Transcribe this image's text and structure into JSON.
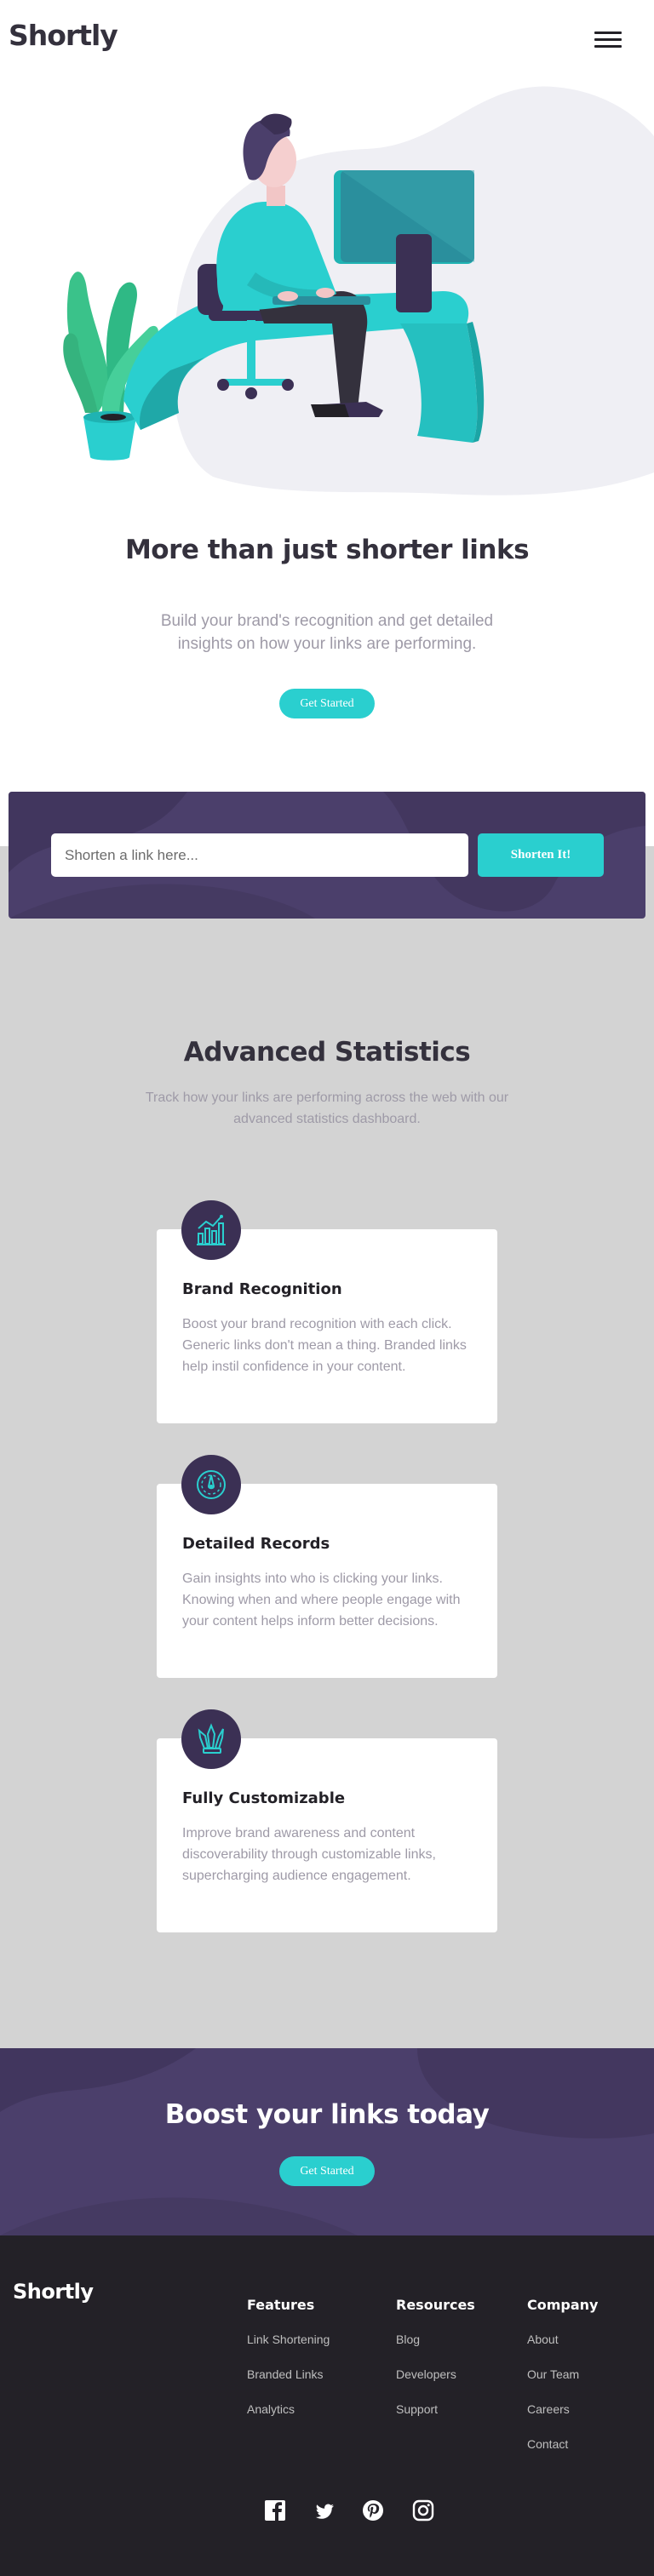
{
  "header": {
    "logo": "Shortly",
    "menu_icon": "hamburger-menu-icon"
  },
  "hero": {
    "illustration": "person-working-at-desk-illustration",
    "title": "More than just shorter links",
    "subtitle": "Build your brand's recognition and get detailed insights on how your links are performing.",
    "button_label": "Get Started"
  },
  "shorten": {
    "placeholder": "Shorten a link here...",
    "button_label": "Shorten It!"
  },
  "statistics": {
    "title": "Advanced Statistics",
    "subtitle": "Track how your links are performing across the web with our advanced statistics dashboard.",
    "cards": [
      {
        "icon": "bar-chart-icon",
        "title": "Brand Recognition",
        "text": "Boost your brand recognition with each click. Generic links don't mean a thing. Branded links help instil confidence in your content."
      },
      {
        "icon": "gauge-icon",
        "title": "Detailed Records",
        "text": "Gain insights into who is clicking your links. Knowing when and where people engage with your content helps inform better decisions."
      },
      {
        "icon": "brushes-icon",
        "title": "Fully Customizable",
        "text": "Improve brand awareness and content discoverability through customizable links, supercharging audience engagement."
      }
    ]
  },
  "boost": {
    "title": "Boost your links today",
    "button_label": "Get Started"
  },
  "footer": {
    "logo": "Shortly",
    "columns": [
      {
        "heading": "Features",
        "links": [
          "Link Shortening",
          "Branded Links",
          "Analytics"
        ]
      },
      {
        "heading": "Resources",
        "links": [
          "Blog",
          "Developers",
          "Support"
        ]
      },
      {
        "heading": "Company",
        "links": [
          "About",
          "Our Team",
          "Careers",
          "Contact"
        ]
      }
    ],
    "socials": [
      "facebook-icon",
      "twitter-icon",
      "pinterest-icon",
      "instagram-icon"
    ]
  },
  "colors": {
    "primary_cyan": "#2acfcf",
    "dark_violet": "#3b3054",
    "panel_violet": "#4b3f6b",
    "gray_text": "#9e9aa7",
    "very_dark_violet": "#232127",
    "section_gray": "#d3d3d3"
  }
}
